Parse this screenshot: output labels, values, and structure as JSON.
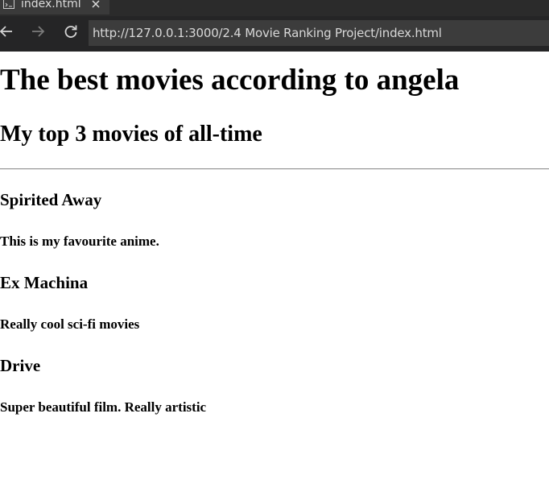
{
  "browser": {
    "tab": {
      "title": "index.html",
      "icon": "file-code-icon",
      "close_icon": "close-icon"
    },
    "nav": {
      "back_icon": "arrow-left-icon",
      "forward_icon": "arrow-right-icon",
      "reload_icon": "reload-icon"
    },
    "address": "http://127.0.0.1:3000/2.4 Movie Ranking Project/index.html",
    "colors": {
      "chrome": "#252526",
      "address_bar": "#3c3c3c",
      "text": "#d8d8d8"
    }
  },
  "page": {
    "title": "The best movies according to angela",
    "subtitle": "My top 3 movies of all-time",
    "movies": [
      {
        "title": "Spirited Away",
        "description": "This is my favourite anime."
      },
      {
        "title": "Ex Machina",
        "description": "Really cool sci-fi movies"
      },
      {
        "title": "Drive",
        "description": "Super beautiful film. Really artistic"
      }
    ]
  }
}
